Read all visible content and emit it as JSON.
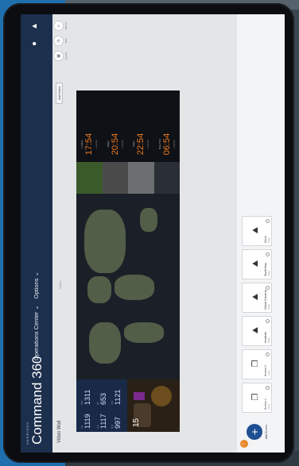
{
  "header": {
    "brand_small": "HARRISON",
    "app_title": "Command 360",
    "nav_items": [
      "Operations Center ⌄",
      "Options ⌄"
    ],
    "icons": [
      "user-icon",
      "bell-icon"
    ]
  },
  "subheader": {
    "title": "Video Wall",
    "search_hint": "search",
    "filter_label": "Add Wallet",
    "actions": [
      {
        "icon": "layout-icon",
        "label": "Layout"
      },
      {
        "icon": "clock-icon",
        "label": "Time"
      },
      {
        "icon": "person-icon",
        "label": "Person"
      }
    ]
  },
  "wall": {
    "stats": [
      {
        "label": "DSL",
        "value": "1119"
      },
      {
        "label": "OPS",
        "value": "1311"
      },
      {
        "label": "SLA",
        "value": "1117"
      },
      {
        "label": "QA",
        "value": "653"
      },
      {
        "label": "OPS",
        "value": "997"
      },
      {
        "label": "SYS",
        "value": "1121"
      }
    ],
    "map_number": "15",
    "clocks": [
      {
        "city": "London",
        "time": "17:54",
        "sub": "Local time"
      },
      {
        "city": "Dubai",
        "time": "20:54",
        "sub": "Local time"
      },
      {
        "city": "Tokyo",
        "time": "22:54",
        "sub": "Local time"
      },
      {
        "city": "New York",
        "time": "06:54",
        "sub": "Local time"
      }
    ]
  },
  "strip": {
    "add_label": "Add Screen",
    "thumbnails": [
      {
        "name": "Screen 1",
        "meta": "Layout"
      },
      {
        "name": "Screen 2",
        "meta": "Layout"
      },
      {
        "name": "Incidents",
        "meta": "Image"
      },
      {
        "name": "Global Cameras",
        "meta": "Image"
      },
      {
        "name": "World Map",
        "meta": "Image"
      },
      {
        "name": "Clock",
        "meta": "Image"
      }
    ]
  },
  "colors": {
    "topbar": "#1c2f4d",
    "accent_orange": "#f07a1e",
    "add_button": "#1f4f93",
    "page_background": "#1f6fae"
  }
}
